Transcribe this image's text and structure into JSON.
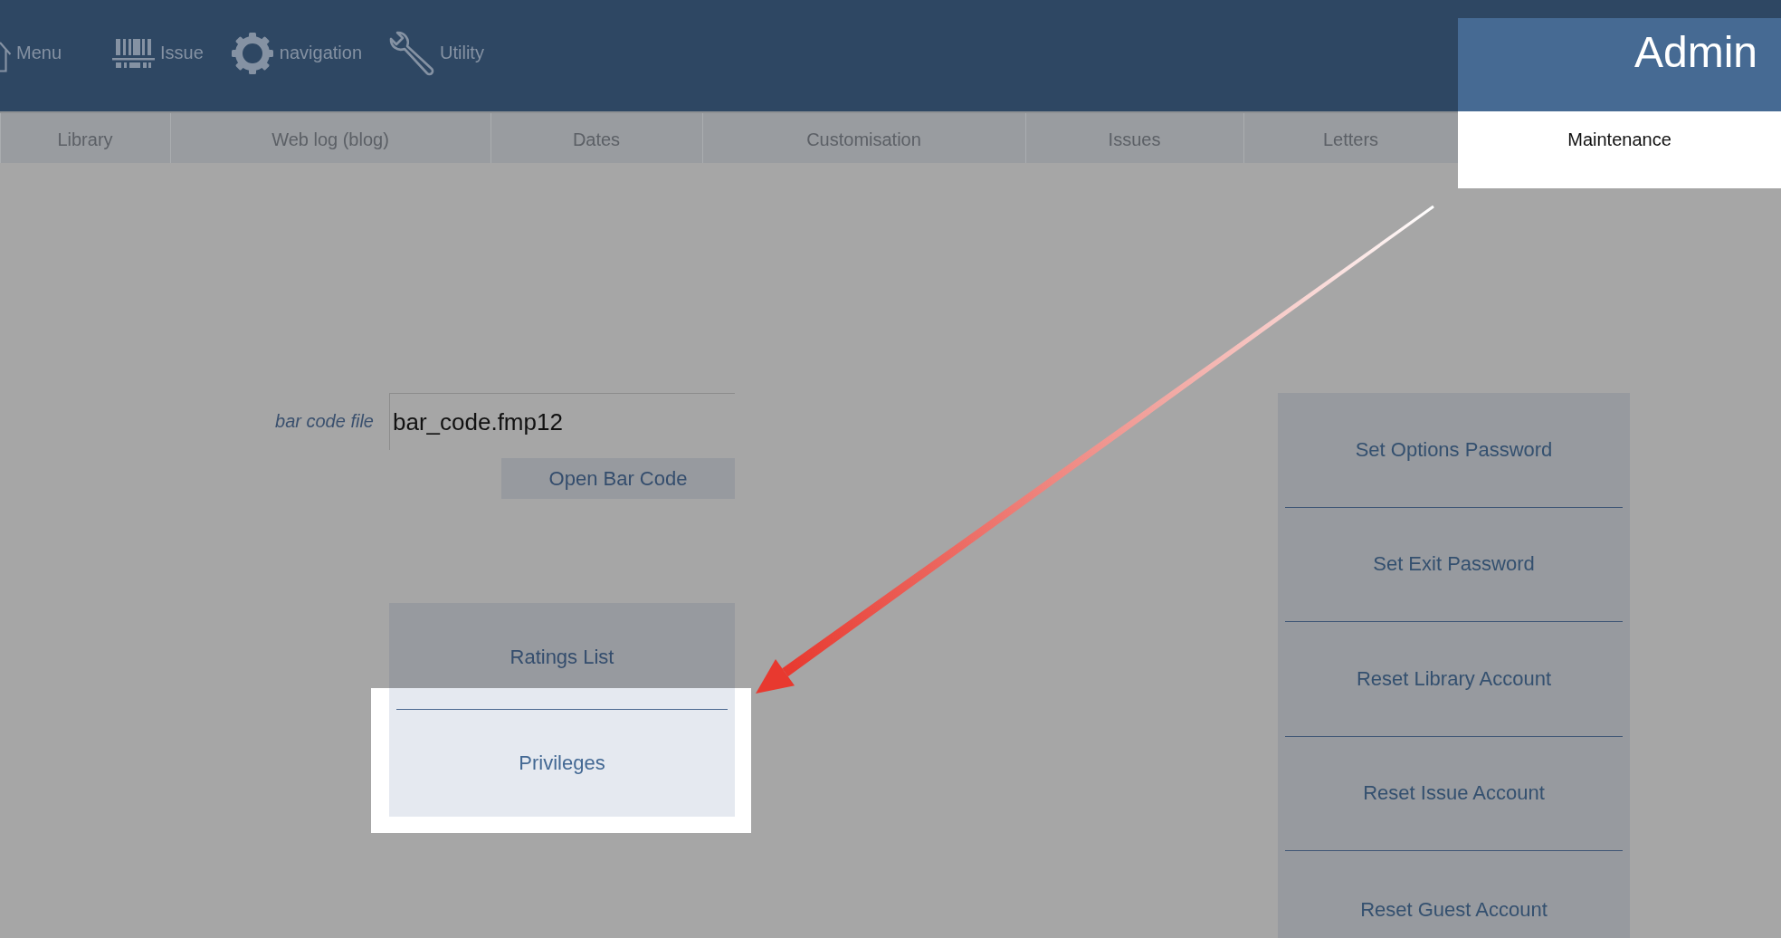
{
  "nav": {
    "items": [
      {
        "kind": "home",
        "label": "Menu"
      },
      {
        "kind": "barcode",
        "label": "Issue"
      },
      {
        "kind": "gear",
        "label": "navigation"
      },
      {
        "kind": "wrench",
        "label": "Utility"
      }
    ]
  },
  "section_title": "Admin",
  "tabs": [
    {
      "label": "Library",
      "selected": false
    },
    {
      "label": "Web log (blog)",
      "selected": false
    },
    {
      "label": "Dates",
      "selected": false
    },
    {
      "label": "Customisation",
      "selected": false
    },
    {
      "label": "Issues",
      "selected": false
    },
    {
      "label": "Letters",
      "selected": false
    },
    {
      "label": "Maintenance",
      "selected": true
    }
  ],
  "bar_code_file": {
    "label": "bar code file",
    "value": "bar_code.fmp12",
    "button": "Open Bar Code"
  },
  "left_buttons": [
    {
      "label": "Ratings List",
      "highlighted": false
    },
    {
      "label": "Privileges",
      "highlighted": true
    }
  ],
  "right_buttons": [
    "Set Options Password",
    "Set Exit Password",
    "Reset Library Account",
    "Reset Issue Account",
    "Reset Guest Account"
  ]
}
